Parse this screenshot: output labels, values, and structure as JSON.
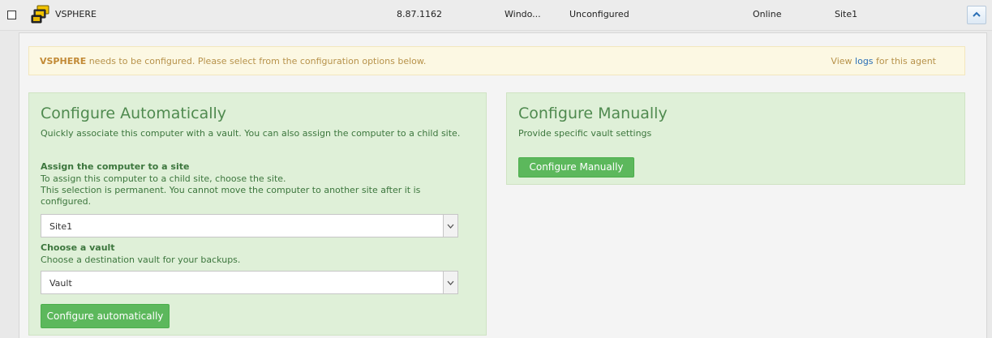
{
  "agent": {
    "name": "VSPHERE",
    "ip": "8.87.1162",
    "os": "Windo...",
    "config_status": "Unconfigured",
    "online_status": "Online",
    "site": "Site1",
    "icon": "server-agent-icon",
    "collapse_icon": "chevron-up-icon"
  },
  "notice": {
    "agent_name": "VSPHERE",
    "message": " needs to be configured. Please select from the configuration options below.",
    "view_prefix": "View ",
    "logs_link": "logs",
    "view_suffix": " for this agent"
  },
  "auto": {
    "title": "Configure Automatically",
    "description": "Quickly associate this computer with a vault. You can also assign the computer to a child site.",
    "site_label": "Assign the computer to a site",
    "site_help_1": "To assign this computer to a child site, choose the site.",
    "site_help_2": "This selection is permanent. You cannot move the computer to another site after it is configured.",
    "site_value": "Site1",
    "vault_label": "Choose a vault",
    "vault_help": "Choose a destination vault for your backups.",
    "vault_value": "Vault",
    "button": "Configure automatically"
  },
  "manual": {
    "title": "Configure Manually",
    "description": "Provide specific vault settings",
    "button": "Configure Manually"
  },
  "colors": {
    "success_bg": "#dff0d8",
    "success_text": "#3c763d",
    "button_green": "#5cb85c",
    "warning_bg": "#fcf8e3",
    "link_blue": "#2a6fb6"
  }
}
